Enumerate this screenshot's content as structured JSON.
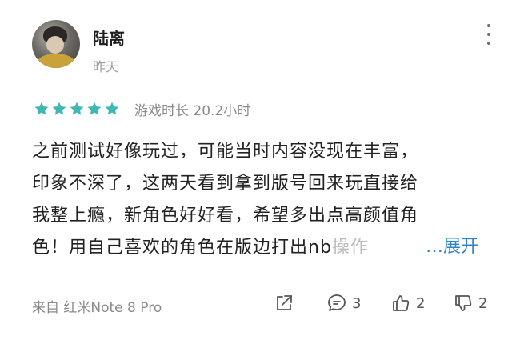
{
  "user": {
    "name": "陆离",
    "time": "昨天"
  },
  "rating": {
    "stars": 5,
    "star_color": "#3fb8b3",
    "playtime": "游戏时长 20.2小时"
  },
  "review": {
    "lines": [
      "之前测试好像玩过，可能当时内容没现在丰富，",
      "印象不深了，这两天看到拿到版号回来玩直接给",
      "我整上瘾，新角色好好看，希望多出点高颜值角"
    ],
    "last_line_main": "色！用自己喜欢的角色在版边打出nb",
    "last_line_fade": "操作",
    "expand": "…展开"
  },
  "footer": {
    "device": "来自 红米Note 8 Pro",
    "comments": "3",
    "likes": "2",
    "dislikes": "2"
  },
  "icons": [
    "more-icon",
    "share-icon",
    "comment-icon",
    "thumb-up-icon",
    "thumb-down-icon",
    "star-icon"
  ]
}
